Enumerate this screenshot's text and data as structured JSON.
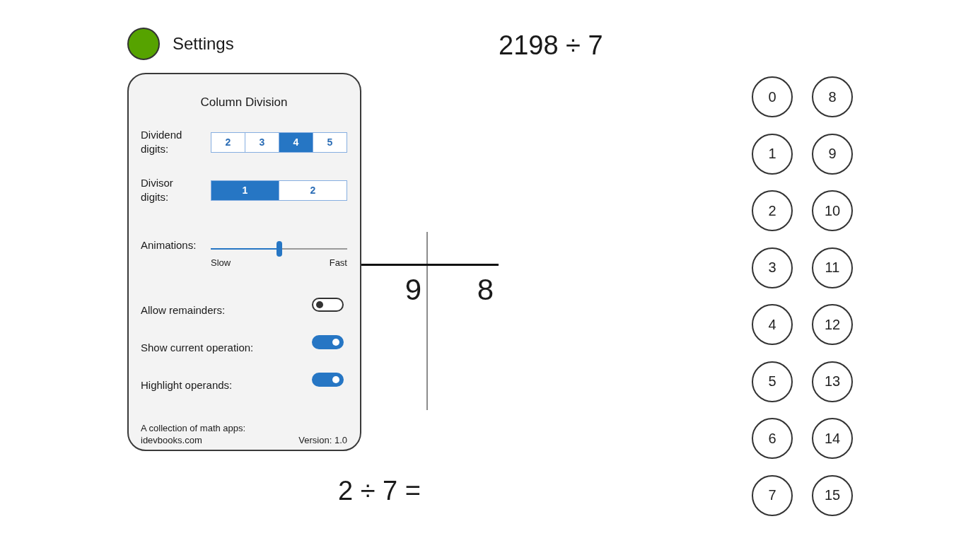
{
  "header": {
    "title": "Settings"
  },
  "problem": "2198 ÷ 7",
  "settings_panel": {
    "title": "Column Division",
    "dividend_digits": {
      "label": "Dividend digits:",
      "options": [
        {
          "label": "2",
          "selected": false
        },
        {
          "label": "3",
          "selected": false
        },
        {
          "label": "4",
          "selected": true
        },
        {
          "label": "5",
          "selected": false
        }
      ]
    },
    "divisor_digits": {
      "label": "Divisor digits:",
      "options": [
        {
          "label": "1",
          "selected": true
        },
        {
          "label": "2",
          "selected": false
        }
      ]
    },
    "animations": {
      "label": "Animations:",
      "level": 0.5,
      "min_label": "Slow",
      "max_label": "Fast"
    },
    "toggles": [
      {
        "label": "Allow remainders:",
        "on": false
      },
      {
        "label": "Show current operation:",
        "on": true
      },
      {
        "label": "Highlight operands:",
        "on": true
      }
    ],
    "footer": {
      "note": "A collection of math apps:",
      "link": "idevbooks.com",
      "version": "Version: 1.0"
    }
  },
  "board": {
    "digits": [
      "9",
      "8"
    ]
  },
  "current_operation": "2 ÷ 7 =",
  "keypad": {
    "columns": [
      [
        "0",
        "1",
        "2",
        "3",
        "4",
        "5",
        "6",
        "7"
      ],
      [
        "8",
        "9",
        "10",
        "11",
        "12",
        "13",
        "14",
        "15"
      ]
    ]
  }
}
